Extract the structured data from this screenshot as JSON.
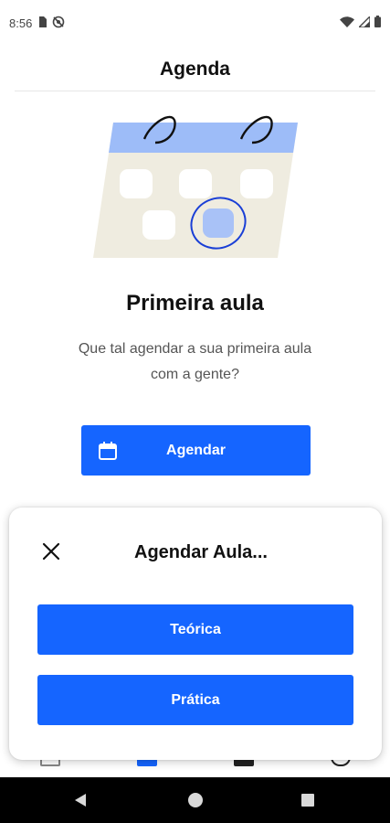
{
  "status_bar": {
    "time": "8:56",
    "left_icons": [
      "sim-card-icon",
      "no-tracking-icon"
    ],
    "right_icons": [
      "wifi-icon",
      "signal-icon",
      "battery-icon"
    ]
  },
  "header": {
    "title": "Agenda"
  },
  "illustration": {
    "name": "calendar-illustration",
    "colors": {
      "band": "#9dbcf8",
      "body": "#efece0",
      "ring": "#1a3fd6"
    }
  },
  "empty_state": {
    "title": "Primeira aula",
    "description": "Que tal agendar a sua primeira aula com a gente?",
    "cta_label": "Agendar",
    "cta_icon": "calendar-icon"
  },
  "sheet": {
    "title": "Agendar Aula...",
    "close_icon": "close-icon",
    "options": [
      {
        "label": "Teórica"
      },
      {
        "label": "Prática"
      }
    ]
  },
  "android_nav": {
    "icons": [
      "back-icon",
      "home-icon",
      "recents-icon"
    ]
  },
  "colors": {
    "primary": "#1565ff",
    "text": "#111111",
    "muted": "#555555"
  }
}
